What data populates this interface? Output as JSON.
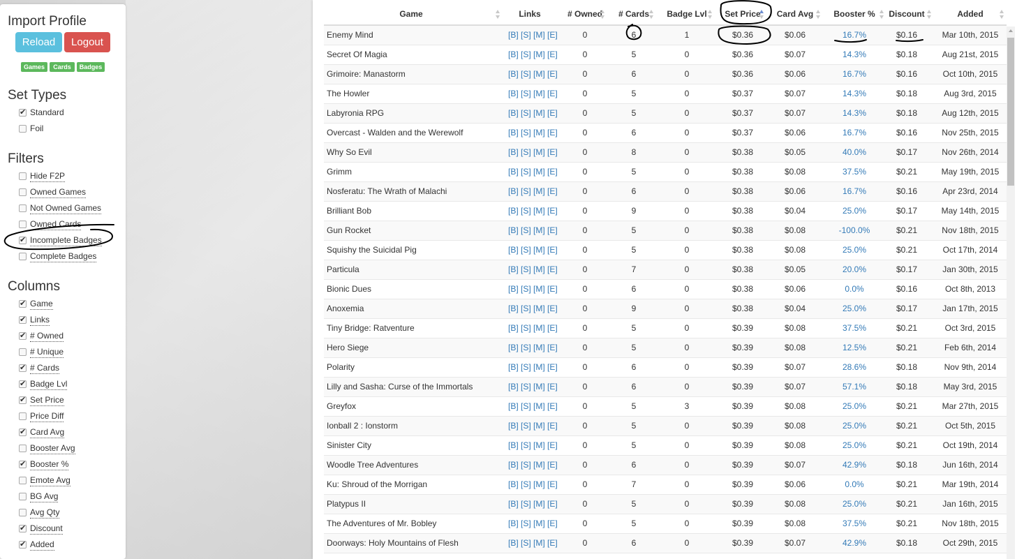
{
  "sidebar": {
    "import_title": "Import Profile",
    "reload_label": "Reload",
    "logout_label": "Logout",
    "tags": [
      "Games",
      "Cards",
      "Badges"
    ],
    "set_types_title": "Set Types",
    "set_types": [
      {
        "label": "Standard",
        "checked": true
      },
      {
        "label": "Foil",
        "checked": false
      }
    ],
    "filters_title": "Filters",
    "filters": [
      {
        "label": "Hide F2P",
        "checked": false
      },
      {
        "label": "Owned Games",
        "checked": false
      },
      {
        "label": "Not Owned Games",
        "checked": false
      },
      {
        "label": "Owned Cards",
        "checked": false
      },
      {
        "label": "Incomplete Badges",
        "checked": true
      },
      {
        "label": "Complete Badges",
        "checked": false
      }
    ],
    "columns_title": "Columns",
    "columns": [
      {
        "label": "Game",
        "checked": true
      },
      {
        "label": "Links",
        "checked": true
      },
      {
        "label": "# Owned",
        "checked": true
      },
      {
        "label": "# Unique",
        "checked": false
      },
      {
        "label": "# Cards",
        "checked": true
      },
      {
        "label": "Badge Lvl",
        "checked": true
      },
      {
        "label": "Set Price",
        "checked": true
      },
      {
        "label": "Price Diff",
        "checked": false
      },
      {
        "label": "Card Avg",
        "checked": true
      },
      {
        "label": "Booster Avg",
        "checked": false
      },
      {
        "label": "Booster %",
        "checked": true
      },
      {
        "label": "Emote Avg",
        "checked": false
      },
      {
        "label": "BG Avg",
        "checked": false
      },
      {
        "label": "Avg Qty",
        "checked": false
      },
      {
        "label": "Discount",
        "checked": true
      },
      {
        "label": "Added",
        "checked": true
      }
    ]
  },
  "table": {
    "headers": {
      "game": "Game",
      "links": "Links",
      "owned": "# Owned",
      "cards": "# Cards",
      "lvl": "Badge Lvl",
      "set": "Set Price",
      "avg": "Card Avg",
      "boost": "Booster %",
      "disc": "Discount",
      "added": "Added"
    },
    "links_text": "[B] [S] [M] [E]",
    "rows": [
      [
        "Enemy Mind",
        "0",
        "6",
        "1",
        "$0.36",
        "$0.06",
        "16.7%",
        "$0.16",
        "Mar 10th, 2015"
      ],
      [
        "Secret Of Magia",
        "0",
        "5",
        "0",
        "$0.36",
        "$0.07",
        "14.3%",
        "$0.18",
        "Aug 21st, 2015"
      ],
      [
        "Grimoire: Manastorm",
        "0",
        "6",
        "0",
        "$0.36",
        "$0.06",
        "16.7%",
        "$0.16",
        "Oct 10th, 2015"
      ],
      [
        "The Howler",
        "0",
        "5",
        "0",
        "$0.37",
        "$0.07",
        "14.3%",
        "$0.18",
        "Aug 3rd, 2015"
      ],
      [
        "Labyronia RPG",
        "0",
        "5",
        "0",
        "$0.37",
        "$0.07",
        "14.3%",
        "$0.18",
        "Aug 12th, 2015"
      ],
      [
        "Overcast - Walden and the Werewolf",
        "0",
        "6",
        "0",
        "$0.37",
        "$0.06",
        "16.7%",
        "$0.16",
        "Nov 25th, 2015"
      ],
      [
        "Why So Evil",
        "0",
        "8",
        "0",
        "$0.38",
        "$0.05",
        "40.0%",
        "$0.17",
        "Nov 26th, 2014"
      ],
      [
        "Grimm",
        "0",
        "5",
        "0",
        "$0.38",
        "$0.08",
        "37.5%",
        "$0.21",
        "May 19th, 2015"
      ],
      [
        "Nosferatu: The Wrath of Malachi",
        "0",
        "6",
        "0",
        "$0.38",
        "$0.06",
        "16.7%",
        "$0.16",
        "Apr 23rd, 2014"
      ],
      [
        "Brilliant Bob",
        "0",
        "9",
        "0",
        "$0.38",
        "$0.04",
        "25.0%",
        "$0.17",
        "May 14th, 2015"
      ],
      [
        "Gun Rocket",
        "0",
        "5",
        "0",
        "$0.38",
        "$0.08",
        "-100.0%",
        "$0.21",
        "Nov 18th, 2015"
      ],
      [
        "Squishy the Suicidal Pig",
        "0",
        "5",
        "0",
        "$0.38",
        "$0.08",
        "25.0%",
        "$0.21",
        "Oct 17th, 2014"
      ],
      [
        "Particula",
        "0",
        "7",
        "0",
        "$0.38",
        "$0.05",
        "20.0%",
        "$0.17",
        "Jan 30th, 2015"
      ],
      [
        "Bionic Dues",
        "0",
        "6",
        "0",
        "$0.38",
        "$0.06",
        "0.0%",
        "$0.16",
        "Oct 8th, 2013"
      ],
      [
        "Anoxemia",
        "0",
        "9",
        "0",
        "$0.38",
        "$0.04",
        "25.0%",
        "$0.17",
        "Jan 17th, 2015"
      ],
      [
        "Tiny Bridge: Ratventure",
        "0",
        "5",
        "0",
        "$0.39",
        "$0.08",
        "37.5%",
        "$0.21",
        "Oct 3rd, 2015"
      ],
      [
        "Hero Siege",
        "0",
        "5",
        "0",
        "$0.39",
        "$0.08",
        "12.5%",
        "$0.21",
        "Feb 6th, 2014"
      ],
      [
        "Polarity",
        "0",
        "6",
        "0",
        "$0.39",
        "$0.07",
        "28.6%",
        "$0.18",
        "Nov 9th, 2014"
      ],
      [
        "Lilly and Sasha: Curse of the Immortals",
        "0",
        "6",
        "0",
        "$0.39",
        "$0.07",
        "57.1%",
        "$0.18",
        "May 3rd, 2015"
      ],
      [
        "Greyfox",
        "0",
        "5",
        "3",
        "$0.39",
        "$0.08",
        "25.0%",
        "$0.21",
        "Mar 27th, 2015"
      ],
      [
        "Ionball 2 : Ionstorm",
        "0",
        "5",
        "0",
        "$0.39",
        "$0.08",
        "25.0%",
        "$0.21",
        "Oct 5th, 2015"
      ],
      [
        "Sinister City",
        "0",
        "5",
        "0",
        "$0.39",
        "$0.08",
        "25.0%",
        "$0.21",
        "Oct 19th, 2014"
      ],
      [
        "Woodle Tree Adventures",
        "0",
        "6",
        "0",
        "$0.39",
        "$0.07",
        "42.9%",
        "$0.18",
        "Jun 16th, 2014"
      ],
      [
        "Ku: Shroud of the Morrigan",
        "0",
        "7",
        "0",
        "$0.39",
        "$0.06",
        "0.0%",
        "$0.21",
        "Mar 19th, 2014"
      ],
      [
        "Platypus II",
        "0",
        "5",
        "0",
        "$0.39",
        "$0.08",
        "25.0%",
        "$0.21",
        "Jan 16th, 2015"
      ],
      [
        "The Adventures of Mr. Bobley",
        "0",
        "5",
        "0",
        "$0.39",
        "$0.08",
        "37.5%",
        "$0.21",
        "Nov 18th, 2015"
      ],
      [
        "Doorways: Holy Mountains of Flesh",
        "0",
        "6",
        "0",
        "$0.39",
        "$0.07",
        "42.9%",
        "$0.18",
        "Oct 29th, 2015"
      ]
    ]
  }
}
